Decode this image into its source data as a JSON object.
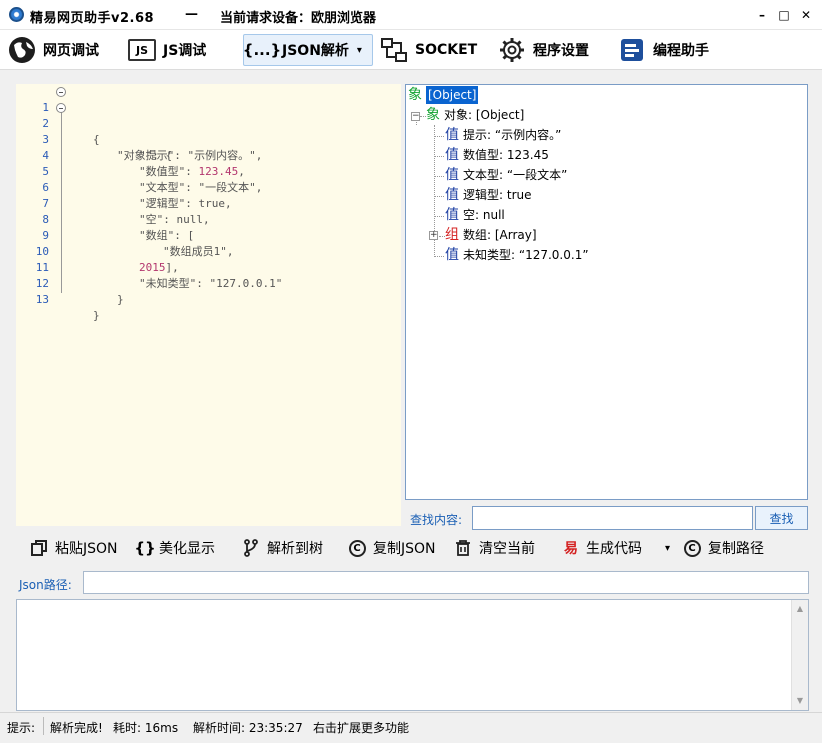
{
  "window": {
    "title": "精易网页助手v2.68",
    "dash": "—",
    "device_label": "当前请求设备：欧朋浏览器",
    "minimize": "–",
    "maximize": "□",
    "close": "✕"
  },
  "toolbar": {
    "web_debug": "网页调试",
    "js_debug": "JS调试",
    "js_icon_text": "JS",
    "json_parse": "JSON解析",
    "json_icon_text": "{...}",
    "socket": "SOCKET",
    "settings": "程序设置",
    "assistant": "编程助手",
    "dropdown_arrow": "▾"
  },
  "editor": {
    "lines": [
      {
        "no": "1",
        "text": "{"
      },
      {
        "no": "2",
        "text": "\"对象\": {"
      },
      {
        "no": "3",
        "text": "\"提示\": \"示例内容。\","
      },
      {
        "no": "4",
        "key": "\"数值型\": ",
        "num": "123.45",
        "tail": ","
      },
      {
        "no": "5",
        "text": "\"文本型\": \"一段文本\","
      },
      {
        "no": "6",
        "text": "\"逻辑型\": true,"
      },
      {
        "no": "7",
        "text": "\"空\": null,"
      },
      {
        "no": "8",
        "text": "\"数组\": ["
      },
      {
        "no": "9",
        "text": "\"数组成员1\","
      },
      {
        "no": "10",
        "num": "2015",
        "tail": "],"
      },
      {
        "no": "11",
        "text": "\"未知类型\": \"127.0.0.1\""
      },
      {
        "no": "12",
        "text": "}"
      },
      {
        "no": "13",
        "text": "}"
      }
    ]
  },
  "tree": {
    "root": {
      "glyph": "象",
      "label": "[Object]"
    },
    "object_node": {
      "glyph": "象",
      "label": "对象: [Object]"
    },
    "children": [
      {
        "glyph": "值",
        "label": "提示: “示例内容。”"
      },
      {
        "glyph": "值",
        "label": "数值型: 123.45"
      },
      {
        "glyph": "值",
        "label": "文本型: “一段文本”"
      },
      {
        "glyph": "值",
        "label": "逻辑型: true"
      },
      {
        "glyph": "值",
        "label": "空: null"
      },
      {
        "glyph": "组",
        "label": "数组: [Array]"
      },
      {
        "glyph": "值",
        "label": "未知类型: “127.0.0.1”"
      }
    ],
    "collapse_symbol": "−",
    "expand_symbol": "+"
  },
  "search": {
    "label": "查找内容:",
    "value": "",
    "button": "查找"
  },
  "actions": {
    "paste_json": "粘贴JSON",
    "beautify": "美化显示",
    "beautify_icon": "{}",
    "parse_tree": "解析到树",
    "copy_json": "复制JSON",
    "copy_icon": "C",
    "clear_current": "清空当前",
    "gen_code": "生成代码",
    "gen_icon": "易",
    "dropdown_arrow": "▾",
    "copy_path": "复制路径"
  },
  "path": {
    "label": "Json路径:",
    "value": ""
  },
  "output": {
    "value": "",
    "scroll_up": "▲",
    "scroll_down": "▼"
  },
  "status": {
    "hint_label": "提示:",
    "parse_done": "解析完成!",
    "time_cost": "耗时: 16ms",
    "parse_time": "解析时间: 23:35:27",
    "more": "右击扩展更多功能"
  },
  "colors": {
    "accent": "#1a5fb4",
    "editor_bg": "#fefbe9",
    "number": "#b3366e",
    "object_glyph": "#13a330",
    "value_glyph": "#1d3fa3",
    "array_glyph": "#d42222",
    "selection": "#0a64d0"
  }
}
